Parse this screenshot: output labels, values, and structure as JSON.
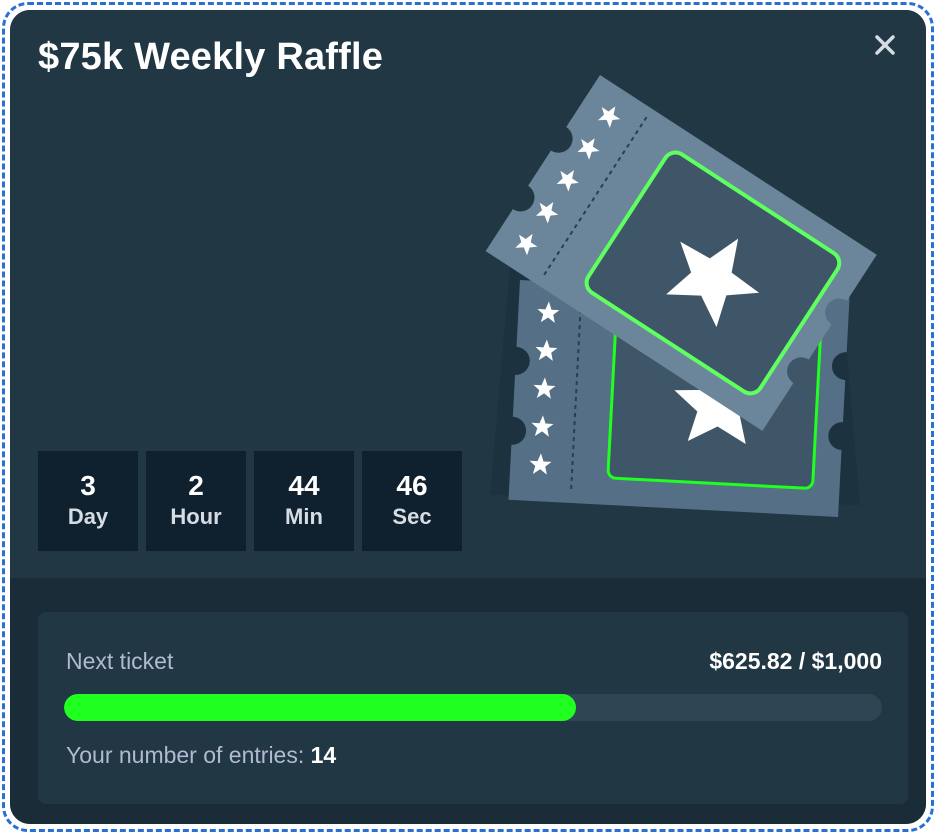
{
  "modal": {
    "title": "$75k Weekly Raffle",
    "close_icon": "close-icon"
  },
  "countdown": [
    {
      "value": "3",
      "unit": "Day"
    },
    {
      "value": "2",
      "unit": "Hour"
    },
    {
      "value": "44",
      "unit": "Min"
    },
    {
      "value": "46",
      "unit": "Sec"
    }
  ],
  "progress": {
    "label": "Next ticket",
    "amount": "$625.82 / $1,000",
    "fraction": 0.62582,
    "entries_label": "Your number of entries:",
    "entries_count": "14"
  },
  "illustration": "raffle-tickets-icon",
  "colors": {
    "background": "#213743",
    "footer_background": "#1a2c38",
    "countdown_box": "#0f212e",
    "accent_green": "#1fff20",
    "track": "#2f4553"
  }
}
